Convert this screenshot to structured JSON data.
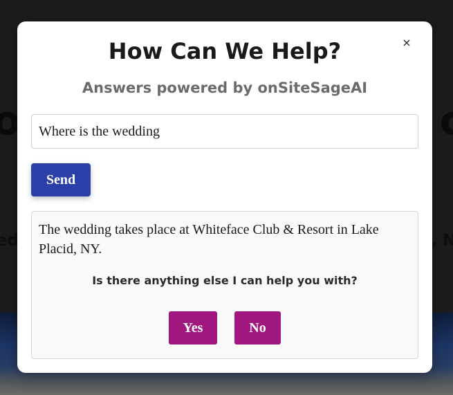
{
  "background": {
    "heading_left": "o",
    "heading_right": "c",
    "sub_left": "ed",
    "sub_right": ", N"
  },
  "modal": {
    "close_label": "×",
    "title": "How Can We Help?",
    "subtitle": "Answers powered by onSiteSageAI",
    "input": {
      "value": "Where is the wedding",
      "placeholder": ""
    },
    "send_label": "Send",
    "answer": "The wedding takes place at Whiteface Club & Resort in Lake Placid, NY.",
    "followup_question": "Is there anything else I can help you with?",
    "yes_label": "Yes",
    "no_label": "No"
  },
  "colors": {
    "send_button": "#2a3fa8",
    "choice_button": "#a0177f"
  }
}
